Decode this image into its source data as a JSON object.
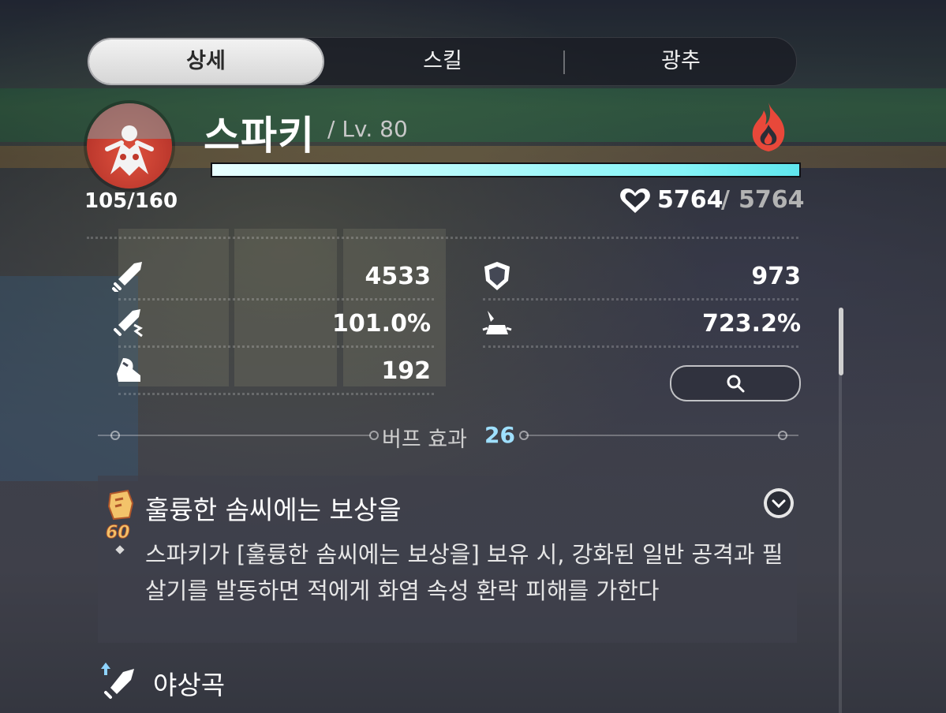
{
  "tabs": [
    {
      "label": "상세",
      "active": true
    },
    {
      "label": "스킬",
      "active": false
    },
    {
      "label": "광추",
      "active": false
    }
  ],
  "character": {
    "name": "스파키",
    "level_text": "/ Lv. 80",
    "energy": "105/160",
    "hp_current": "5764",
    "hp_separator": "/",
    "hp_max": "5764",
    "hp_fraction": 1.0,
    "element_icon": "fire-element-icon"
  },
  "stats": {
    "attack": {
      "icon": "sword-icon",
      "value": "4533"
    },
    "defense": {
      "icon": "shield-icon",
      "value": "973"
    },
    "crit_rate": {
      "icon": "crit-sword-icon",
      "value": "101.0%"
    },
    "crit_damage": {
      "icon": "crit-hand-icon",
      "value": "723.2%"
    },
    "speed": {
      "icon": "boot-icon",
      "value": "192"
    }
  },
  "buffs": {
    "label": "버프 효과",
    "count": "26",
    "items": [
      {
        "icon_badge": "60",
        "title": "훌륭한 솜씨에는 보상을",
        "description": "스파키가 [훌륭한 솜씨에는 보상을] 보유 시, 강화된 일반 공격과 필살기를 발동하면 적에게 화염 속성 환락 피해를 가한다"
      },
      {
        "title": "야상곡"
      }
    ]
  },
  "colors": {
    "hp_bar": "#86f4f7",
    "buff_count": "#9fe0ff",
    "portrait": "#e0523e",
    "element": "#e8483a"
  }
}
